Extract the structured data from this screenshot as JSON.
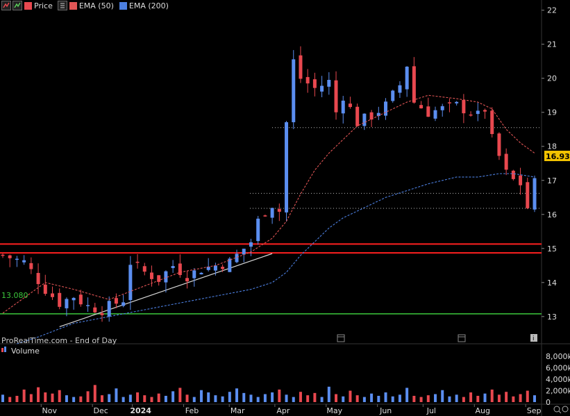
{
  "legend": {
    "price_label": "Price",
    "ema50_label": "EMA (50)",
    "ema200_label": "EMA (200)",
    "volume_label": "Volume"
  },
  "footer_text": "ProRealTime.com - End of Day",
  "last_price_label": "16.930",
  "support_level_label": "13.080",
  "colors": {
    "up": "#5b8ef0",
    "down": "#e8484f",
    "ema50": "#e05555",
    "ema200": "#4c7fe0",
    "support": "#3cc83c",
    "resistance": "#ff2020",
    "background": "#000000",
    "last_price_badge": "#f2c200"
  },
  "icons": [
    "price-series-icon",
    "menu-icon",
    "calendar-icon",
    "info-icon"
  ],
  "chart_data": {
    "type": "candlestick",
    "x_labels": [
      "Nov",
      "Dec",
      "2024",
      "Feb",
      "Mar",
      "Apr",
      "May",
      "Jun",
      "Jul",
      "Aug",
      "Sep"
    ],
    "price_axis": {
      "ylim": [
        12.2,
        22.3
      ],
      "ticks": [
        13,
        14,
        15,
        16,
        17,
        18,
        19,
        20,
        21,
        22
      ]
    },
    "volume_axis": {
      "ticks": [
        "8,000k",
        "6,000k",
        "4,000k",
        "2,000k",
        "0"
      ],
      "ylim": [
        0,
        9000
      ]
    },
    "close_path": [
      [
        0,
        14.8
      ],
      [
        3,
        14.6
      ],
      [
        6,
        13.8
      ],
      [
        8,
        13.4
      ],
      [
        10,
        13.6
      ],
      [
        12,
        13.3
      ],
      [
        14,
        13.2
      ],
      [
        15,
        13.3
      ],
      [
        17,
        13.5
      ],
      [
        18,
        14.6
      ],
      [
        20,
        14.3
      ],
      [
        22,
        14.1
      ],
      [
        24,
        14.5
      ],
      [
        26,
        14.2
      ],
      [
        28,
        14.4
      ],
      [
        30,
        14.5
      ],
      [
        32,
        14.6
      ],
      [
        34,
        15.0
      ],
      [
        35,
        15.2
      ],
      [
        36,
        15.8
      ],
      [
        37,
        16.1
      ],
      [
        38,
        16.3
      ],
      [
        39,
        16.1
      ],
      [
        40,
        18.7
      ],
      [
        41,
        20.5
      ],
      [
        42,
        20.0
      ],
      [
        44,
        19.7
      ],
      [
        46,
        19.9
      ],
      [
        47,
        19.0
      ],
      [
        48,
        19.5
      ],
      [
        50,
        18.7
      ],
      [
        52,
        18.9
      ],
      [
        54,
        19.2
      ],
      [
        56,
        19.8
      ],
      [
        57,
        20.4
      ],
      [
        58,
        19.3
      ],
      [
        60,
        19.0
      ],
      [
        62,
        19.1
      ],
      [
        64,
        19.2
      ],
      [
        66,
        19.0
      ],
      [
        67,
        18.9
      ],
      [
        68,
        19.1
      ],
      [
        69,
        18.2
      ],
      [
        70,
        17.7
      ],
      [
        71,
        17.2
      ],
      [
        72,
        17.0
      ],
      [
        73,
        16.9
      ],
      [
        74,
        16.2
      ],
      [
        75,
        16.93
      ]
    ],
    "ema50": [
      [
        0,
        13.1
      ],
      [
        6,
        14.0
      ],
      [
        10,
        13.8
      ],
      [
        15,
        13.5
      ],
      [
        20,
        13.9
      ],
      [
        25,
        14.3
      ],
      [
        30,
        14.5
      ],
      [
        35,
        14.9
      ],
      [
        38,
        15.3
      ],
      [
        40,
        15.8
      ],
      [
        42,
        16.6
      ],
      [
        44,
        17.3
      ],
      [
        46,
        17.8
      ],
      [
        48,
        18.2
      ],
      [
        50,
        18.6
      ],
      [
        54,
        19.0
      ],
      [
        57,
        19.3
      ],
      [
        60,
        19.5
      ],
      [
        64,
        19.4
      ],
      [
        67,
        19.3
      ],
      [
        69,
        19.1
      ],
      [
        71,
        18.5
      ],
      [
        73,
        18.1
      ],
      [
        75,
        17.8
      ]
    ],
    "ema200": [
      [
        2,
        12.2
      ],
      [
        5,
        12.4
      ],
      [
        10,
        12.8
      ],
      [
        15,
        13.0
      ],
      [
        20,
        13.2
      ],
      [
        25,
        13.4
      ],
      [
        30,
        13.6
      ],
      [
        35,
        13.8
      ],
      [
        38,
        14.0
      ],
      [
        40,
        14.3
      ],
      [
        42,
        14.8
      ],
      [
        44,
        15.2
      ],
      [
        46,
        15.6
      ],
      [
        48,
        15.9
      ],
      [
        50,
        16.1
      ],
      [
        54,
        16.5
      ],
      [
        57,
        16.7
      ],
      [
        60,
        16.9
      ],
      [
        64,
        17.1
      ],
      [
        67,
        17.1
      ],
      [
        70,
        17.2
      ],
      [
        72,
        17.2
      ],
      [
        75,
        17.1
      ]
    ],
    "horizontal_levels": [
      {
        "value": 13.08,
        "kind": "support"
      },
      {
        "value": 14.87,
        "kind": "resistance"
      },
      {
        "value": 15.13,
        "kind": "resistance"
      },
      {
        "value": 18.55,
        "kind": "dotted"
      },
      {
        "value": 16.62,
        "kind": "dotted"
      },
      {
        "value": 16.18,
        "kind": "dotted"
      }
    ],
    "trendline": {
      "from": [
        8,
        12.7
      ],
      "to": [
        38,
        14.85
      ]
    },
    "volume": [
      1300,
      900,
      1100,
      2200,
      1400,
      2600,
      1700,
      1500,
      2100,
      1200,
      900,
      1000,
      1900,
      3000,
      1200,
      1400,
      2400,
      900,
      1300,
      1700,
      1200,
      900,
      1500,
      1100,
      1900,
      2500,
      1300,
      900,
      2100,
      1700,
      1200,
      1000,
      1800,
      2400,
      1600,
      1300,
      900,
      1400,
      1700,
      2200,
      1300,
      900,
      1800,
      1200,
      1600,
      900,
      2700,
      1400,
      1000,
      2000,
      1200,
      900,
      1500,
      1100,
      1700,
      1000,
      1300,
      2500,
      1100,
      900,
      1200,
      1400,
      2100,
      1000,
      1300,
      900,
      1700,
      1100,
      1500,
      2200,
      1300,
      1800,
      1000,
      1400,
      2000,
      1200
    ]
  }
}
